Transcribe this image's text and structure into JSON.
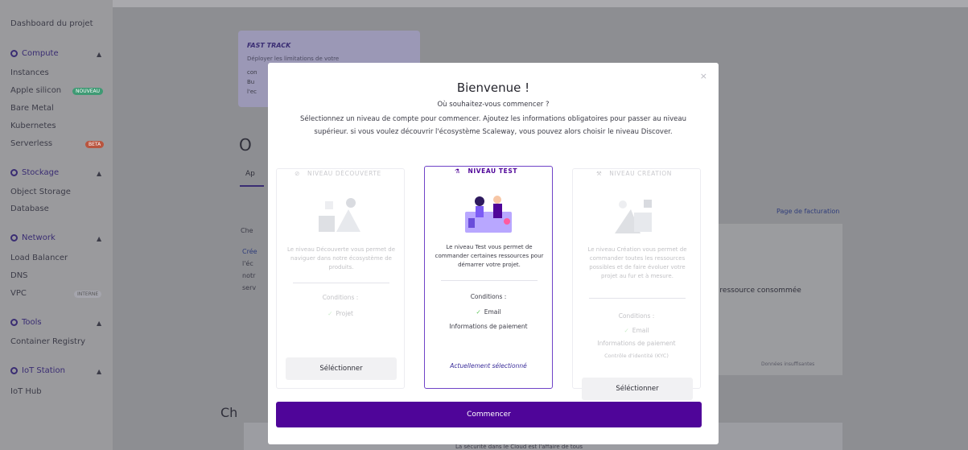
{
  "sidebar": {
    "dashboard": "Dashboard du projet",
    "compute": {
      "label": "Compute",
      "items": [
        "Instances",
        "Apple silicon",
        "Bare Metal",
        "Kubernetes",
        "Serverless"
      ],
      "badge_new": "NOUVEAU",
      "badge_beta": "BETA"
    },
    "storage": {
      "label": "Stockage",
      "items": [
        "Object Storage",
        "Database"
      ]
    },
    "network": {
      "label": "Network",
      "items": [
        "Load Balancer",
        "DNS",
        "VPC"
      ],
      "badge_vpc": "INTERNE"
    },
    "tools": {
      "label": "Tools",
      "items": [
        "Container Registry"
      ]
    },
    "iot": {
      "label": "IoT Station",
      "items": [
        "IoT Hub"
      ]
    }
  },
  "background": {
    "fast_track_title": "FAST TRACK",
    "fast_track_text": "Déployer les limitations de votre",
    "big_o": "O",
    "tab_ap": "Ap",
    "billing_link": "Page de facturation",
    "consumption_text": "e ressource consommée",
    "last_data": "Données insuffisantes",
    "ch": "Ch",
    "security": "La sécurité dans le Cloud est l'affaire de tous",
    "misc1": "Che",
    "misc2": "Crée",
    "misc3": "l'éc",
    "misc4": "notr",
    "misc5": "serv",
    "misc6": "con",
    "misc7": "Bu",
    "misc8": "l'ec"
  },
  "modal": {
    "close": "×",
    "title": "Bienvenue !",
    "question": "Où souhaitez-vous commencer ?",
    "description": "Sélectionnez un niveau de compte pour commencer. Ajoutez les informations obligatoires pour passer au niveau supérieur.  si vous voulez découvrir l'écosystème Scaleway, vous pouvez alors choisir le niveau Discover.",
    "start_button": "Commencer",
    "cards": [
      {
        "title": "NIVEAU DÉCOUVERTE",
        "text": "Le niveau Découverte vous permet de naviguer dans notre écosystème de produits.",
        "conditions_label": "Conditions :",
        "conditions": [
          "Projet"
        ],
        "button": "Séléctionner"
      },
      {
        "title": "NIVEAU TEST",
        "text": "Le niveau Test vous permet de commander certaines ressources pour démarrer votre projet.",
        "conditions_label": "Conditions :",
        "conditions": [
          "Email",
          "Informations de paiement"
        ],
        "current": "Actuellement sélectionné"
      },
      {
        "title": "NIVEAU CRÉATION",
        "text": "Le niveau Création vous permet de commander toutes les ressources possibles et de faire évoluer votre projet au fur et à mesure.",
        "conditions_label": "Conditions :",
        "conditions": [
          "Email",
          "Informations de paiement",
          "Contrôle d'identité (KYC)"
        ],
        "button": "Séléctionner"
      }
    ]
  },
  "colors": {
    "brand": "#4f0599",
    "selected_border": "#6f43c7",
    "check": "#5ec55a"
  }
}
